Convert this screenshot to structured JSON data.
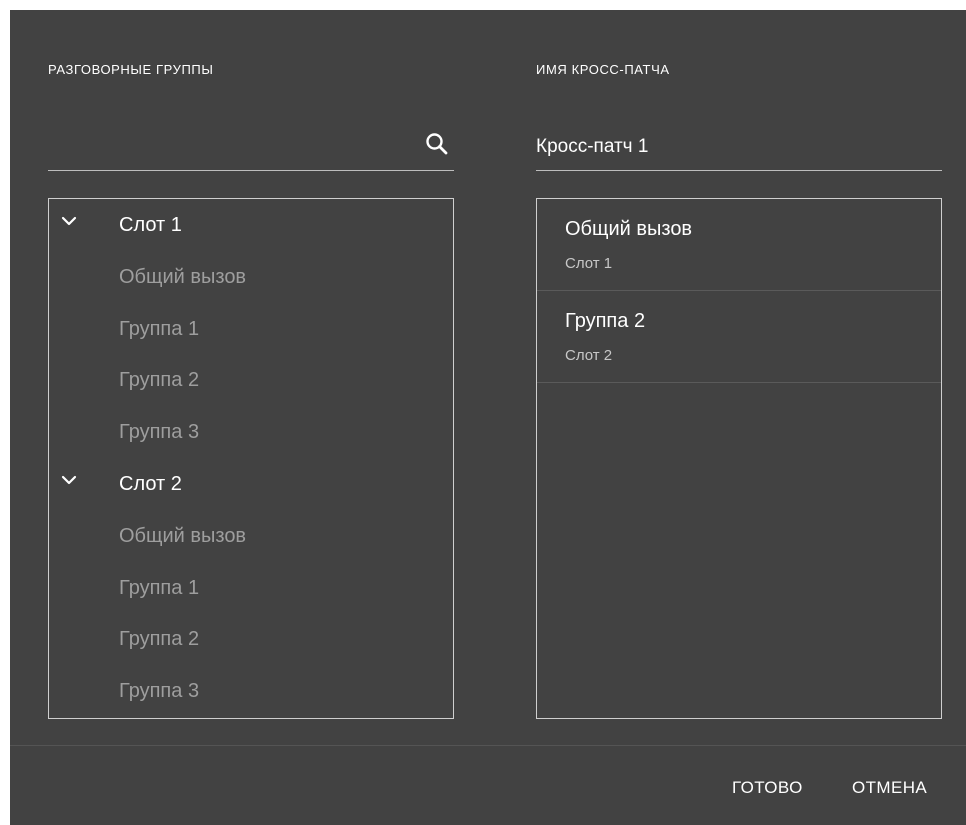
{
  "dialog": {
    "talkgroups_label": "РАЗГОВОРНЫЕ ГРУППЫ",
    "patch_name_label": "ИМЯ КРОСС-ПАТЧА",
    "search": {
      "value": "",
      "placeholder": ""
    },
    "patch_name": {
      "value": "Кросс-патч 1"
    },
    "tree": [
      {
        "kind": "slot",
        "label": "Слот 1",
        "expanded": true,
        "icon": "chevron-down-icon"
      },
      {
        "kind": "group",
        "label": "Общий вызов"
      },
      {
        "kind": "group",
        "label": "Группа 1"
      },
      {
        "kind": "group",
        "label": "Группа 2"
      },
      {
        "kind": "group",
        "label": "Группа 3"
      },
      {
        "kind": "slot",
        "label": "Слот 2",
        "expanded": true,
        "icon": "chevron-down-icon"
      },
      {
        "kind": "group",
        "label": "Общий вызов"
      },
      {
        "kind": "group",
        "label": "Группа 1"
      },
      {
        "kind": "group",
        "label": "Группа 2"
      },
      {
        "kind": "group",
        "label": "Группа 3"
      }
    ],
    "selected": [
      {
        "title": "Общий вызов",
        "subtitle": "Слот 1"
      },
      {
        "title": "Группа 2",
        "subtitle": "Слот 2"
      }
    ],
    "actions": {
      "done_label": "ГОТОВО",
      "cancel_label": "ОТМЕНА"
    },
    "colors": {
      "background": "#424242",
      "text_primary": "#ffffff",
      "text_secondary": "#9e9e9e",
      "border": "#cfcfcf"
    }
  }
}
